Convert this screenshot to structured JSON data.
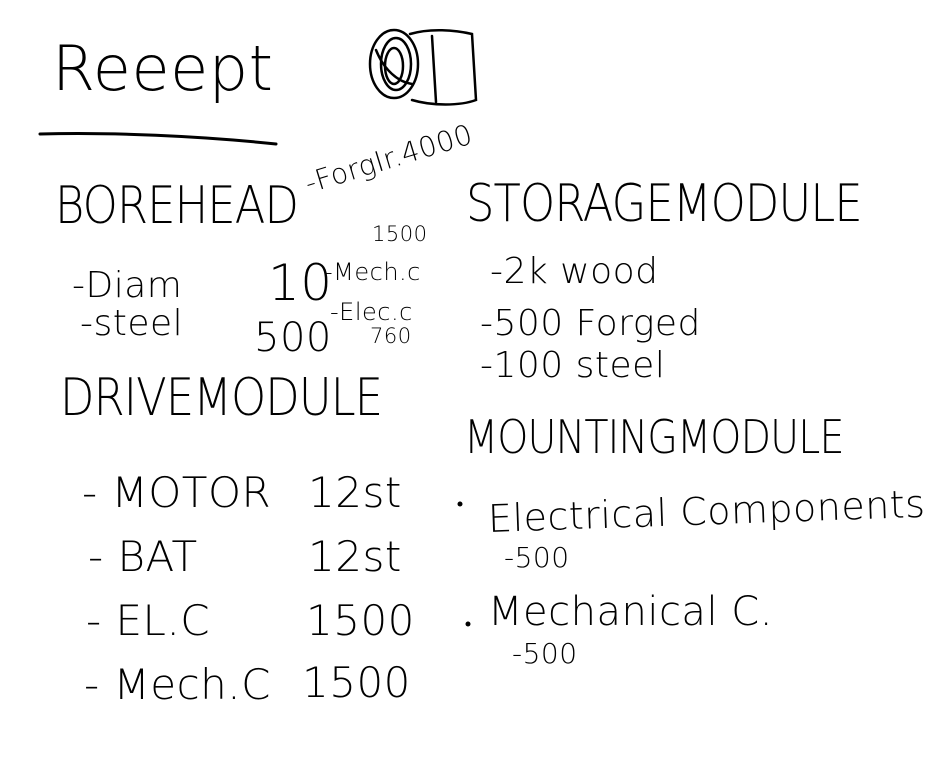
{
  "title": "Reeept",
  "borehead": {
    "heading": "BOREHEAD",
    "items": [
      {
        "label": "-Diam",
        "value": "10"
      },
      {
        "label": "-steel",
        "value": "500"
      }
    ],
    "notes": [
      "-ForgIr.4000",
      "1500",
      "-Mech.c",
      "-Elec.c",
      "760"
    ]
  },
  "storage_module": {
    "heading": "STORAGEMODULE",
    "items": [
      "-2k wood",
      "-500 Forged",
      "-100 steel"
    ]
  },
  "drive_module": {
    "heading": "DRIVEMODULE",
    "items": [
      {
        "label": "- MOTOR",
        "value": "12st"
      },
      {
        "label": "- BAT",
        "value": "12st"
      },
      {
        "label": "- EL.C",
        "value": "1500"
      },
      {
        "label": "- Mech.C",
        "value": "1500"
      }
    ]
  },
  "mounting_module": {
    "heading": "MOUNTINGMODULE",
    "items": [
      {
        "label": "Electrical Components",
        "value": "-500"
      },
      {
        "label": "Mechanical C.",
        "value": "-500"
      }
    ]
  }
}
